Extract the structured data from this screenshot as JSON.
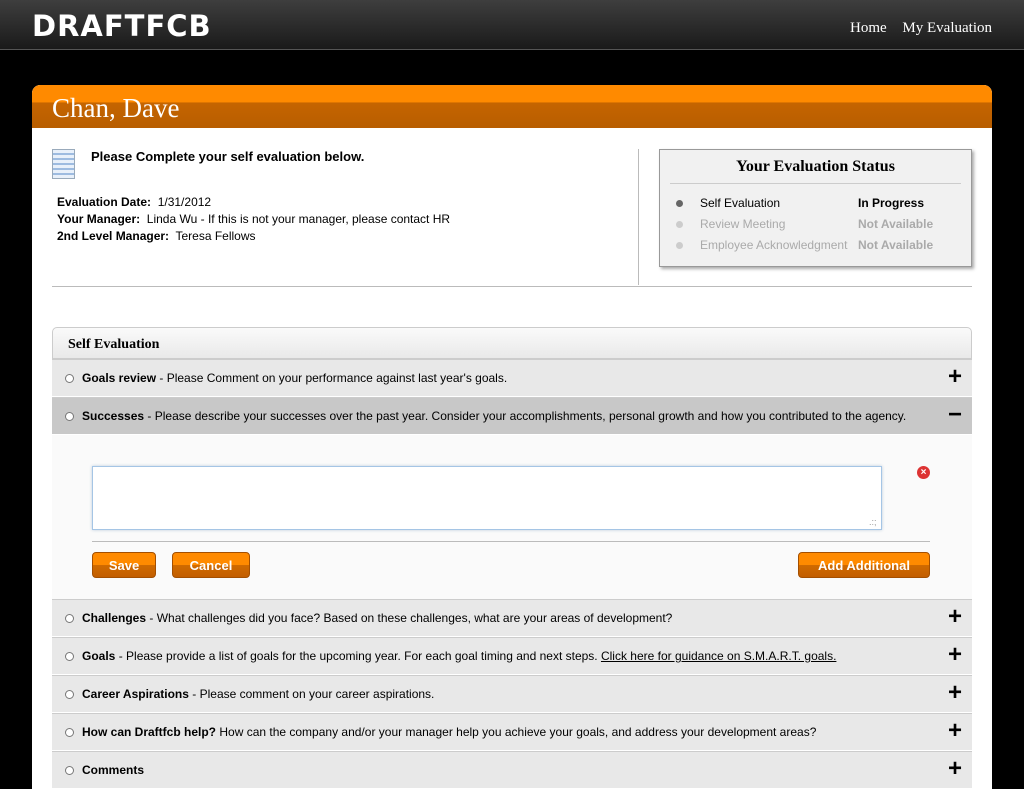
{
  "header": {
    "logo": "DRAFTFCB",
    "nav": [
      "Home",
      "My Evaluation"
    ]
  },
  "employee": {
    "name": "Chan, Dave"
  },
  "intro": "Please Complete your self evaluation below.",
  "info": {
    "eval_date_label": "Evaluation Date:",
    "eval_date": "1/31/2012",
    "manager_label": "Your Manager:",
    "manager": "Linda Wu - If this is not your manager, please contact HR",
    "manager2_label": "2nd Level Manager:",
    "manager2": "Teresa Fellows"
  },
  "status": {
    "title": "Your Evaluation Status",
    "items": [
      {
        "label": "Self Evaluation",
        "value": "In Progress",
        "color": "#000000"
      },
      {
        "label": "Review Meeting",
        "value": "Not Available",
        "color": "#aaaaaa"
      },
      {
        "label": "Employee Acknowledgment",
        "value": "Not Available",
        "color": "#aaaaaa"
      }
    ]
  },
  "self_eval": {
    "title": "Self Evaluation",
    "sections": [
      {
        "title": "Goals review",
        "desc": " - Please Comment on your performance against last year's goals.",
        "toggle": "+"
      },
      {
        "title": "Successes",
        "desc": " - Please describe your successes over the past year. Consider your accomplishments, personal growth and how you contributed to the agency.",
        "toggle": "−"
      },
      {
        "title": "Challenges",
        "desc": " - What challenges did you face? Based on these challenges, what are your areas of development?",
        "toggle": "+"
      },
      {
        "title": "Goals",
        "desc": " - Please provide a list of goals for the upcoming year. For each goal timing and next steps. ",
        "link": "Click here for guidance on S.M.A.R.T. goals.",
        "toggle": "+"
      },
      {
        "title": "Career Aspirations",
        "desc": " - Please comment on your career aspirations.",
        "toggle": "+"
      },
      {
        "title": "How can Draftfcb help?",
        "desc": " How can the company and/or your manager help you achieve your goals, and address your development areas?",
        "toggle": "+"
      },
      {
        "title": "Comments",
        "desc": "",
        "toggle": "+"
      }
    ],
    "editor": {
      "value": "",
      "save_label": "Save",
      "cancel_label": "Cancel",
      "add_label": "Add Additional",
      "delete_icon": "close-icon"
    }
  }
}
